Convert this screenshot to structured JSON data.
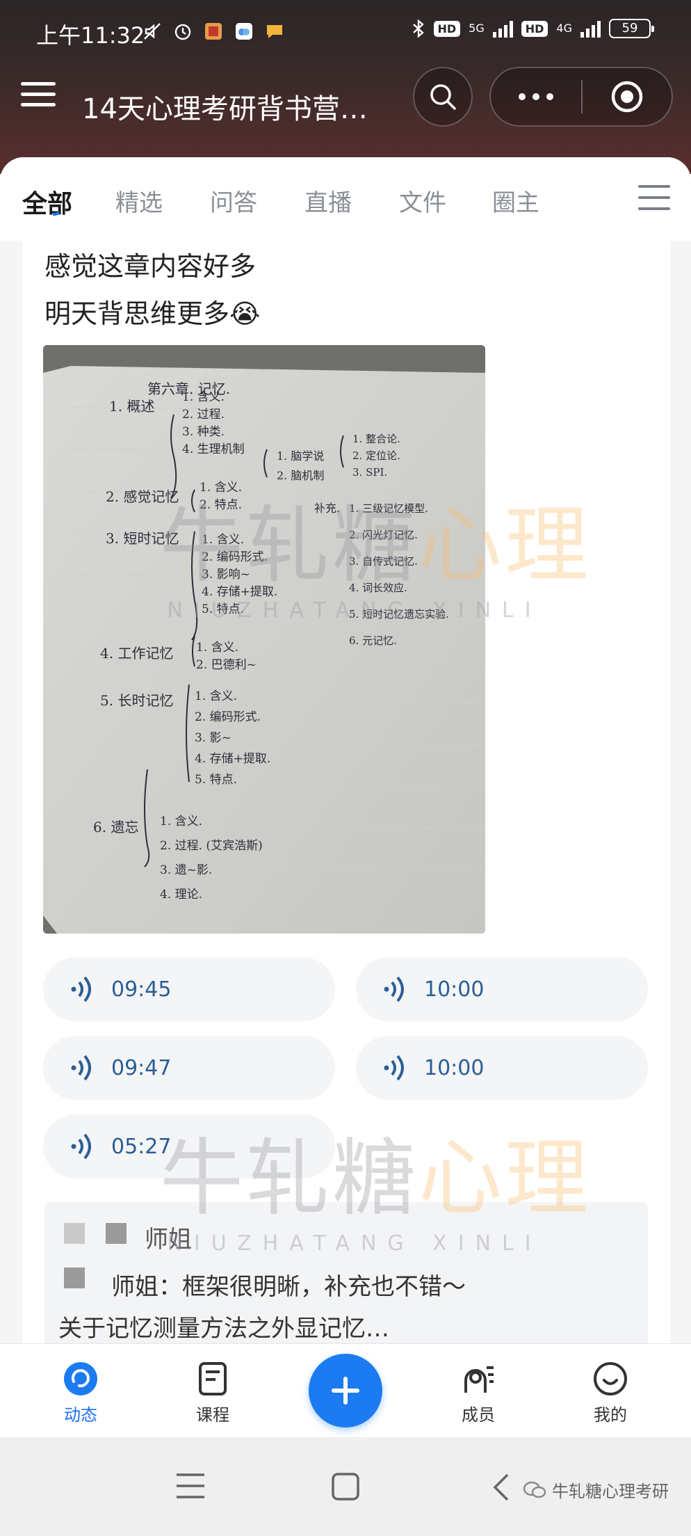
{
  "status_bar": {
    "time": "上午11:32",
    "network_1": "5G",
    "network_2": "4G",
    "hd": "HD",
    "battery": "59"
  },
  "header": {
    "title": "14天心理考研背书营…",
    "icons": [
      "menu-icon",
      "search-icon",
      "more-icon",
      "close-target-icon"
    ]
  },
  "tabs": [
    {
      "label": "全部",
      "active": true
    },
    {
      "label": "精选"
    },
    {
      "label": "问答"
    },
    {
      "label": "直播"
    },
    {
      "label": "文件"
    },
    {
      "label": "圈主"
    }
  ],
  "post": {
    "line1": "感觉这章内容好多",
    "line2": "明天背思维更多😭",
    "voices": [
      "09:45",
      "10:00",
      "09:47",
      "10:00",
      "05:27"
    ]
  },
  "notes": {
    "heading": "第六章. 记忆.",
    "left_column": [
      "1. 概述",
      "1. 含义.",
      "2. 过程.",
      "3. 种类.",
      "4. 生理机制",
      "2. 感觉记忆",
      "1. 含义.",
      "2. 特点.",
      "3. 短时记忆",
      "1. 含义.",
      "2. 编码形式.",
      "3. 影响~",
      "4. 存储+提取.",
      "5. 特点.",
      "4. 工作记忆",
      "1. 含义.",
      "2. 巴德利~",
      "5. 长时记忆",
      "1. 含义.",
      "2. 编码形式.",
      "3. 影~",
      "4. 存储+提取.",
      "5. 特点.",
      "6. 遗忘",
      "1. 含义.",
      "2. 过程. (艾宾浩斯)",
      "3. 遗~影.",
      "4. 理论."
    ],
    "middle_column": [
      "1. 脑学说",
      "2. 脑机制"
    ],
    "right_top": [
      "1. 整合论.",
      "2. 定位论.",
      "3. SPI."
    ],
    "supplement_label": "补充.",
    "right_column": [
      "1. 三级记忆模型.",
      "2. 闪光灯记忆.",
      "3. 自传式记忆.",
      "4. 词长效应.",
      "5. 短时记忆遗忘实验.",
      "6. 元记忆."
    ]
  },
  "watermark": {
    "main_gray": "牛轧糖",
    "main_orange": "心理",
    "sub": "NIUZHATANG XINLI"
  },
  "comment": {
    "name": "师姐",
    "line1": "师姐：框架很明晰，补充也不错～",
    "line2": "关于记忆测量方法之外显记忆…"
  },
  "bottom_nav": [
    {
      "label": "动态",
      "icon": "feed-icon",
      "active": true
    },
    {
      "label": "课程",
      "icon": "course-icon"
    },
    {
      "label": "",
      "icon": "plus-icon"
    },
    {
      "label": "成员",
      "icon": "members-icon"
    },
    {
      "label": "我的",
      "icon": "profile-icon"
    }
  ],
  "system_nav": {
    "tag": "牛轧糖心理考研"
  },
  "colors": {
    "accent": "#1d7bf2",
    "voice_text": "#2a5e95",
    "watermark_orange": "#f5b56a"
  }
}
